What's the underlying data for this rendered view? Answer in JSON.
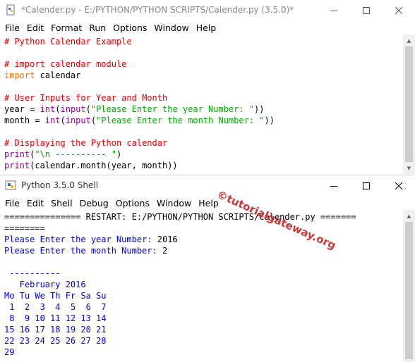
{
  "editor": {
    "title": "*Calender.py - E:/PYTHON/PYTHON SCRIPTS/Calender.py (3.5.0)*",
    "menu": [
      "File",
      "Edit",
      "Format",
      "Run",
      "Options",
      "Window",
      "Help"
    ],
    "code": [
      {
        "text": "# Python Calendar Example",
        "kind": "comment"
      },
      {
        "text": "",
        "kind": "blank"
      },
      {
        "text": "# import calendar module",
        "kind": "comment"
      },
      {
        "text": "import calendar",
        "kind": "import"
      },
      {
        "text": "",
        "kind": "blank"
      },
      {
        "text": "# User Inputs for Year and Month",
        "kind": "comment"
      },
      {
        "text": "year = int(input(\"Please Enter the year Number: \"))",
        "kind": "input-year"
      },
      {
        "text": "month = int(input(\"Please Enter the month Number: \"))",
        "kind": "input-month"
      },
      {
        "text": "",
        "kind": "blank"
      },
      {
        "text": "# Displaying the Python calendar",
        "kind": "comment"
      },
      {
        "text": "print(\"\\n ---------- \")",
        "kind": "print1"
      },
      {
        "text": "print(calendar.month(year, month))",
        "kind": "print2"
      }
    ]
  },
  "shell": {
    "title": "Python 3.5.0 Shell",
    "menu": [
      "File",
      "Edit",
      "Shell",
      "Debug",
      "Options",
      "Window",
      "Help"
    ],
    "output": [
      {
        "text": "=============== RESTART: E:/PYTHON/PYTHON SCRIPTS/Calender.py =======",
        "kind": "out"
      },
      {
        "text": "========",
        "kind": "out"
      },
      {
        "text": "Please Enter the year Number: ",
        "input": "2016",
        "kind": "prompt"
      },
      {
        "text": "Please Enter the month Number: ",
        "input": "2",
        "kind": "prompt"
      },
      {
        "text": "",
        "kind": "blank"
      },
      {
        "text": " ----------",
        "kind": "stdout"
      },
      {
        "text": "   February 2016",
        "kind": "stdout"
      },
      {
        "text": "Mo Tu We Th Fr Sa Su",
        "kind": "stdout"
      },
      {
        "text": " 1  2  3  4  5  6  7",
        "kind": "stdout"
      },
      {
        "text": " 8  9 10 11 12 13 14",
        "kind": "stdout"
      },
      {
        "text": "15 16 17 18 19 20 21",
        "kind": "stdout"
      },
      {
        "text": "22 23 24 25 26 27 28",
        "kind": "stdout"
      },
      {
        "text": "29",
        "kind": "stdout"
      }
    ]
  },
  "watermark": "©tutorialgateway.org",
  "colors": {
    "comment": "#dd0000",
    "keyword": "#ff7700",
    "builtin": "#900090",
    "string": "#00aa00",
    "stdout": "#0000ff"
  }
}
